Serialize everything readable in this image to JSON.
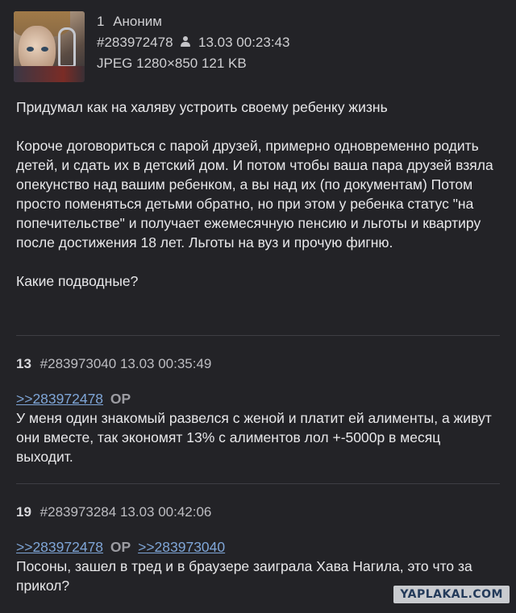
{
  "op": {
    "number": "1",
    "author": "Аноним",
    "post_id": "#283972478",
    "timestamp": "13.03 00:23:43",
    "file_info": "JPEG 1280×850 121 KB",
    "paragraphs": [
      "Придумал как на халяву устроить своему ребенку жизнь",
      "Короче договориться с парой друзей, примерно одновременно родить детей, и сдать их в детский дом. И потом чтобы ваша пара друзей взяла опекунство над вашим ребенком, а вы над их (по документам) Потом просто поменяться детьми обратно, но при этом у ребенка статус \"на попечительстве\" и получает ежемесячную пенсию и льготы и квартиру после достижения 18 лет. Льготы на вуз и прочую фигню.",
      "Какие подводные?"
    ]
  },
  "replies": [
    {
      "number": "13",
      "post_id": "#283973040",
      "timestamp": "13.03 00:35:49",
      "links": [
        {
          "text": ">>283972478",
          "badge": "OP"
        }
      ],
      "text": "У меня один знакомый развелся с женой и платит ей алименты, а живут они вместе, так экономят 13% с алиментов лол +-5000р в месяц выходит."
    },
    {
      "number": "19",
      "post_id": "#283973284",
      "timestamp": "13.03 00:42:06",
      "links": [
        {
          "text": ">>283972478",
          "badge": "OP"
        },
        {
          "text": ">>283973040",
          "badge": ""
        }
      ],
      "text": "Посоны, зашел в тред и в браузере заиграла Хава Нагила, это что за прикол?"
    }
  ],
  "watermark": "YAPLAKAL.COM",
  "colors": {
    "background": "#232327",
    "link": "#7fa6d8",
    "text": "#e8e8ea"
  }
}
